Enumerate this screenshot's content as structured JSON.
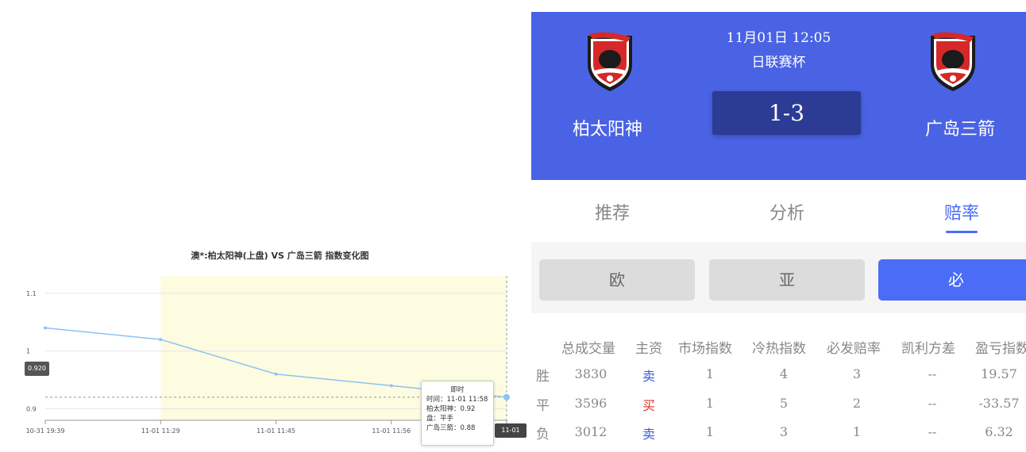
{
  "chart_data": {
    "type": "line",
    "title": "澳*:柏太阳神(上盘) VS 广岛三箭 指数变化图",
    "categories": [
      "10-31 19:39",
      "11-01 11:29",
      "11-01 11:45",
      "11-01 11:56",
      "11-01 11:58"
    ],
    "series": [
      {
        "name": "",
        "values": [
          1.04,
          1.02,
          0.96,
          0.94,
          0.92
        ]
      }
    ],
    "yticks": [
      "1.1",
      "1",
      "0.9"
    ],
    "ylim": [
      0.88,
      1.13
    ],
    "highlight_range": [
      "11-01 11:29",
      "11-01 11:58"
    ],
    "highlight_color": "#fdfbe0",
    "line_color": "#8ec2f3",
    "grid": true,
    "crosshair_y_label": "0.920",
    "crosshair_x_label": "11-01 11:58",
    "tooltip": {
      "title": "即时",
      "lines": [
        "时间：11-01 11:58",
        "柏太阳神：0.92",
        "盘：平手",
        "广岛三箭：0.88"
      ]
    }
  },
  "match": {
    "time": "11月01日 12:05",
    "league": "日联赛杯",
    "score": "1-3",
    "home_team": "柏太阳神",
    "away_team": "广岛三箭",
    "header_color": "#4a63e4"
  },
  "tabs": [
    {
      "label": "推荐",
      "active": false
    },
    {
      "label": "分析",
      "active": false
    },
    {
      "label": "赔率",
      "active": true
    }
  ],
  "subtabs": [
    {
      "label": "欧",
      "active": false
    },
    {
      "label": "亚",
      "active": false
    },
    {
      "label": "必",
      "active": true
    }
  ],
  "table": {
    "headers": [
      "总成交量",
      "主资",
      "市场指数",
      "冷热指数",
      "必发赔率",
      "凯利方差",
      "盈亏指数"
    ],
    "rows": [
      {
        "label": "胜",
        "cells": [
          "3830",
          "卖",
          "1",
          "4",
          "3",
          "--",
          "19.57"
        ]
      },
      {
        "label": "平",
        "cells": [
          "3596",
          "买",
          "1",
          "5",
          "2",
          "--",
          "-33.57"
        ]
      },
      {
        "label": "负",
        "cells": [
          "3012",
          "卖",
          "1",
          "3",
          "1",
          "--",
          "6.32"
        ]
      }
    ]
  },
  "icons": {
    "team_logo": "shield-crest-icon"
  }
}
